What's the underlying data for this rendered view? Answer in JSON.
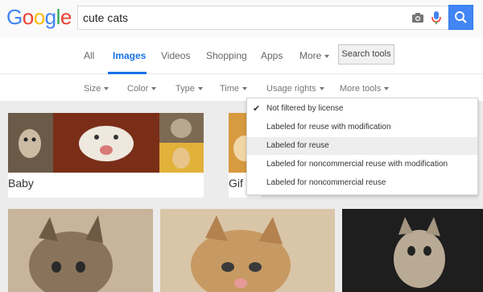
{
  "logo": {
    "text": "Google",
    "letters": [
      "G",
      "o",
      "o",
      "g",
      "l",
      "e"
    ],
    "colors": [
      "#4285f4",
      "#ea4335",
      "#fbbc05",
      "#4285f4",
      "#34a853",
      "#ea4335"
    ]
  },
  "search": {
    "value": "cute cats",
    "button_icon": "search-icon",
    "camera_icon": "camera-icon",
    "mic_icon": "microphone-icon"
  },
  "tabs": [
    {
      "label": "All",
      "active": false
    },
    {
      "label": "Images",
      "active": true
    },
    {
      "label": "Videos",
      "active": false
    },
    {
      "label": "Shopping",
      "active": false
    },
    {
      "label": "Apps",
      "active": false
    },
    {
      "label": "More",
      "active": false
    }
  ],
  "search_tools_label": "Search tools",
  "filters": [
    "Size",
    "Color",
    "Type",
    "Time",
    "Usage rights",
    "More tools"
  ],
  "related": [
    {
      "label": "Baby"
    },
    {
      "label": "Gif"
    }
  ],
  "usage_menu": {
    "options": [
      {
        "label": "Not filtered by license",
        "checked": true,
        "highlighted": false
      },
      {
        "label": "Labeled for reuse with modification",
        "checked": false,
        "highlighted": false
      },
      {
        "label": "Labeled for reuse",
        "checked": false,
        "highlighted": true
      },
      {
        "label": "Labeled for noncommercial reuse with modification",
        "checked": false,
        "highlighted": false
      },
      {
        "label": "Labeled for noncommercial reuse",
        "checked": false,
        "highlighted": false
      }
    ]
  },
  "colors": {
    "accent": "#1a73e8",
    "search_button": "#4285f4"
  }
}
